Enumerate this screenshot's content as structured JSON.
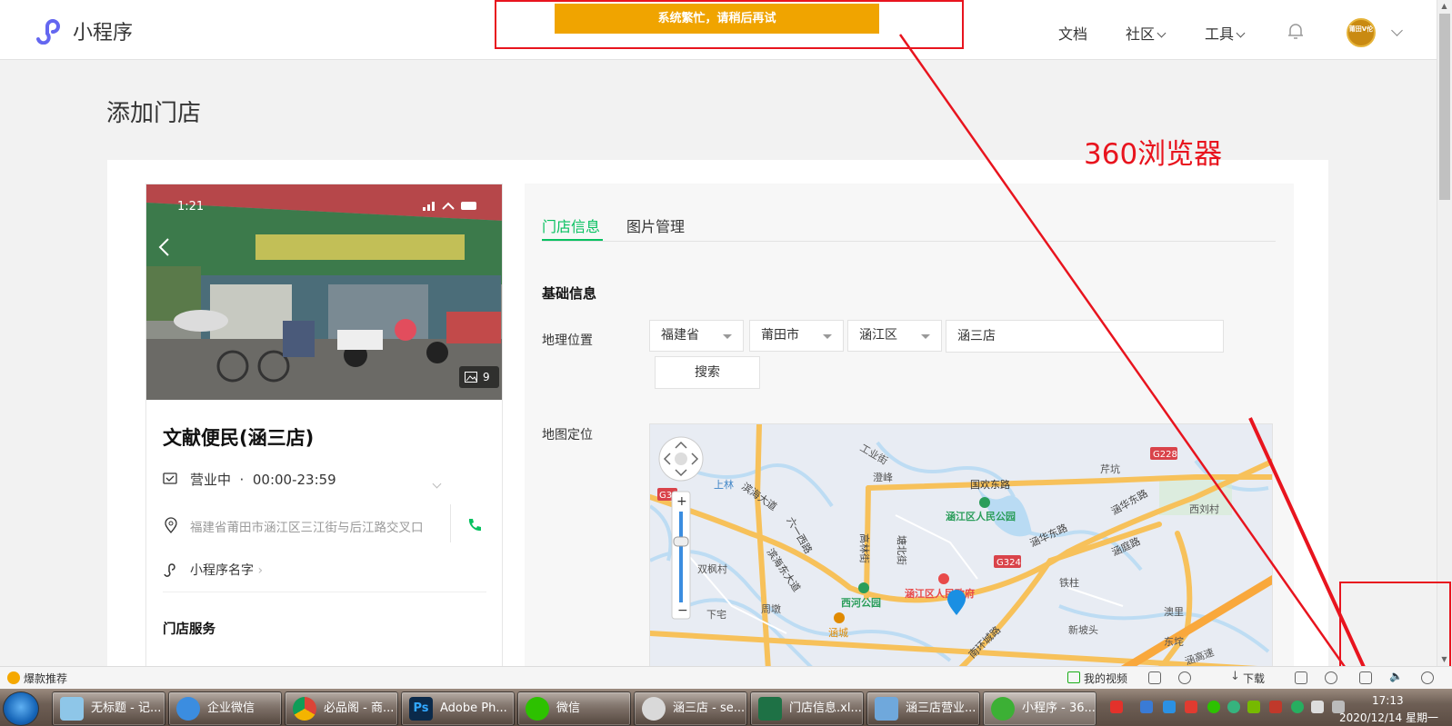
{
  "header": {
    "logo_text": "小程序",
    "toast": "系统繁忙，请稍后再试",
    "nav": {
      "docs": "文档",
      "community": "社区",
      "tools": "工具"
    },
    "avatar_text": "莆田V伦"
  },
  "page": {
    "title": "添加门店"
  },
  "annotation": {
    "label": "360浏览器"
  },
  "preview": {
    "status_time": "1:21",
    "photo_count": "9",
    "store_name": "文献便民(涵三店)",
    "status": "营业中",
    "hours": "00:00-23:59",
    "address": "福建省莆田市涵江区三江街与后江路交叉口",
    "mini_program_name": "小程序名字",
    "section_service": "门店服务"
  },
  "form": {
    "tabs": [
      "门店信息",
      "图片管理"
    ],
    "section_basic": "基础信息",
    "label_location": "地理位置",
    "province": "福建省",
    "city": "莆田市",
    "district": "涵江区",
    "store_input": "涵三店",
    "search_button": "搜索",
    "label_map": "地图定位"
  },
  "map": {
    "labels": {
      "industry_st": "工业街",
      "chengfeng": "澄峰",
      "guohuan_east": "国欢东路",
      "hanhua_east": "涵华东路",
      "qianken": "芹坑",
      "xiliu": "西刘村",
      "shanglin": "上林",
      "binhai": "滨海大道",
      "liuyi_west": "六一西路",
      "hanjiang_park": "涵江区人民公园",
      "gaolin": "高林街",
      "tangbei": "塘北街",
      "hanhua_east2": "涵华东路",
      "hanting": "涵庭路",
      "shuangfeng": "双枫村",
      "binhai_east": "滨海东大道",
      "xihe_park": "西河公园",
      "gov": "涵江区人民政府",
      "tiezhu": "铁柱",
      "zhoudun": "周墩",
      "xiapeng": "下宅",
      "hancheng": "涵城",
      "nanhuan": "南环城路",
      "xinpo": "新坡头",
      "aoli": "澳里",
      "dongao": "东垞",
      "hangu": "涵高速",
      "g228": "G228",
      "g324": "G324",
      "g3": "G3"
    }
  },
  "browser_status": {
    "recommend": "爆款推荐",
    "my_video": "我的视频",
    "download": "下载"
  },
  "taskbar": {
    "items": [
      "无标题 - 记...",
      "企业微信",
      "必品阁 - 商...",
      "Adobe Ph...",
      "微信",
      "涵三店 - se...",
      "门店信息.xl...",
      "涵三店营业...",
      "小程序 - 36..."
    ],
    "clock_time": "17:13",
    "clock_date": "2020/12/14 星期一"
  },
  "colors": {
    "accent": "#07c160",
    "toast": "#f0a400",
    "annotation": "#e8141e",
    "map_road": "#f7c15a"
  }
}
